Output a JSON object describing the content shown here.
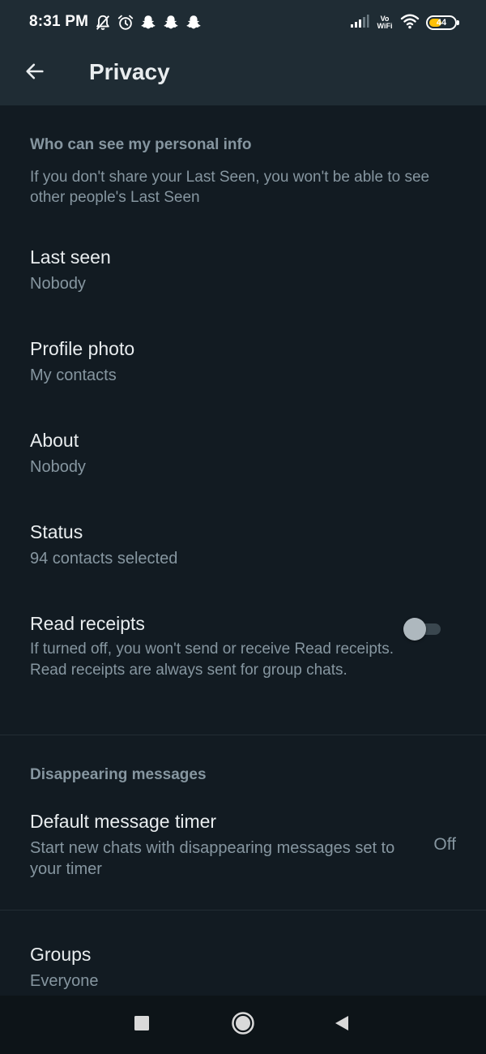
{
  "status_bar": {
    "time": "8:31 PM",
    "left_icons": [
      "bell-off-icon",
      "alarm-icon",
      "snapchat-icon",
      "snapchat-icon",
      "snapchat-icon"
    ],
    "vowifi_line1": "Vo",
    "vowifi_line2": "WiFi",
    "battery_level": "44"
  },
  "header": {
    "title": "Privacy",
    "back_icon": "arrow-left-icon"
  },
  "personal_info": {
    "heading": "Who can see my personal info",
    "description": "If you don't share your Last Seen, you won't be able to see other people's Last Seen",
    "items": [
      {
        "title": "Last seen",
        "value": "Nobody"
      },
      {
        "title": "Profile photo",
        "value": "My contacts"
      },
      {
        "title": "About",
        "value": "Nobody"
      },
      {
        "title": "Status",
        "value": "94 contacts selected"
      }
    ],
    "read_receipts": {
      "title": "Read receipts",
      "description": "If turned off, you won't send or receive Read receipts. Read receipts are always sent for group chats.",
      "enabled": false
    }
  },
  "disappearing": {
    "heading": "Disappearing messages",
    "timer": {
      "title": "Default message timer",
      "description": "Start new chats with disappearing messages set to your timer",
      "value": "Off"
    }
  },
  "groups": {
    "title": "Groups",
    "value": "Everyone"
  },
  "nav_bar": {
    "icons": [
      "recents-square-icon",
      "home-circle-icon",
      "back-triangle-icon"
    ]
  },
  "colors": {
    "background": "#121b22",
    "app_bar": "#1f2c34",
    "primary_text": "#e9edef",
    "secondary_text": "#8696a0",
    "toggle_off": "#aeb8be",
    "battery_accent": "#ffc107"
  }
}
